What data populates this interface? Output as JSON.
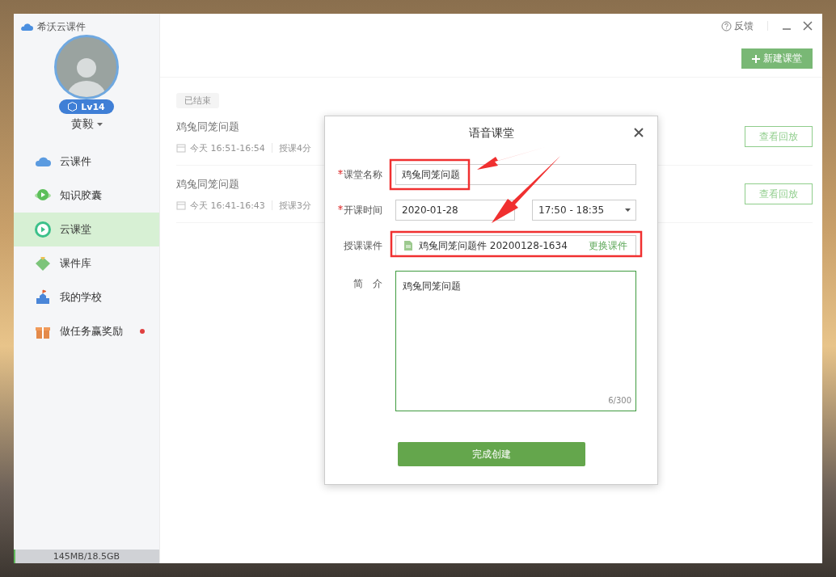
{
  "app": {
    "title": "希沃云课件"
  },
  "user": {
    "name": "黄毅",
    "level_badge": "Lv14"
  },
  "sidebar": {
    "items": [
      {
        "label": "云课件",
        "selected": false,
        "dot": false
      },
      {
        "label": "知识胶囊",
        "selected": false,
        "dot": false
      },
      {
        "label": "云课堂",
        "selected": true,
        "dot": false
      },
      {
        "label": "课件库",
        "selected": false,
        "dot": false
      },
      {
        "label": "我的学校",
        "selected": false,
        "dot": false
      },
      {
        "label": "做任务赢奖励",
        "selected": false,
        "dot": true
      }
    ]
  },
  "storage": {
    "text": "145MB/18.5GB",
    "level": 0.008
  },
  "topbar": {
    "feedback": "反馈",
    "new_button": "新建课堂"
  },
  "status_tag": "已结束",
  "lessons": [
    {
      "title": "鸡兔同笼问题",
      "time": "今天 16:51-16:54",
      "duration": "授课4分",
      "action": "查看回放"
    },
    {
      "title": "鸡兔同笼问题",
      "time": "今天 16:41-16:43",
      "duration": "授课3分",
      "action": "查看回放"
    }
  ],
  "dialog": {
    "title": "语音课堂",
    "name_field": {
      "label": "课堂名称",
      "required": true,
      "value": "鸡兔同笼问题"
    },
    "time_field": {
      "label": "开课时间",
      "required": true,
      "date": "2020-01-28",
      "range": "17:50 - 18:35"
    },
    "courseware_field": {
      "label": "授课课件",
      "required": false,
      "file": "鸡兔同笼问题件 20200128-1634",
      "change_link": "更换课件"
    },
    "intro_field": {
      "label": "简　介",
      "required": false,
      "value": "鸡兔同笼问题",
      "counter": "6/300"
    },
    "submit": "完成创建"
  }
}
